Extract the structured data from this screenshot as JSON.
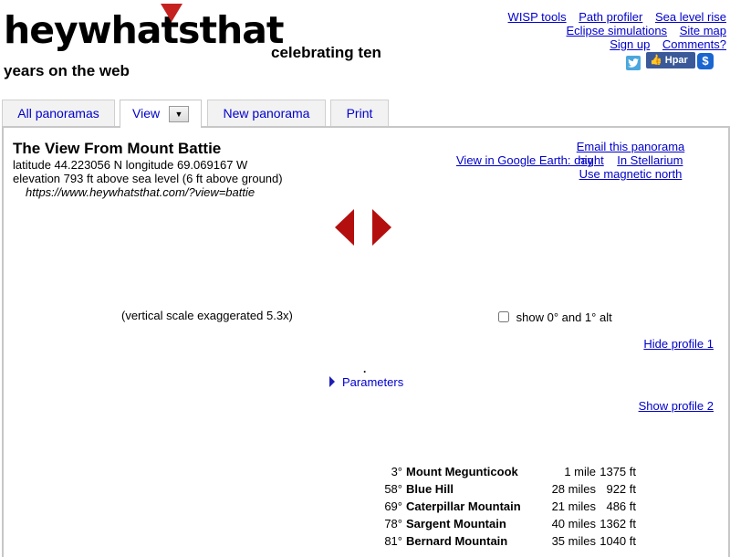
{
  "header": {
    "logo_text": "heywhatsthat",
    "tagline_line1": "celebrating ten",
    "tagline_line2": "years on the web",
    "top_links": {
      "wisp_tools": "WISP tools",
      "path_profiler": "Path profiler",
      "sea_level_rise": "Sea level rise",
      "eclipse_simulations": "Eclipse simulations",
      "site_map": "Site map",
      "sign_up": "Sign up",
      "comments": "Comments?"
    },
    "facebook_label": "Hpar",
    "dollar_label": "$"
  },
  "tabs": {
    "all_panoramas": "All panoramas",
    "view": "View",
    "view_dropdown": "▼",
    "new_panorama": "New panorama",
    "print": "Print"
  },
  "panorama": {
    "title": "The View From Mount Battie",
    "latlon": "latitude 44.223056 N longitude 69.069167 W",
    "elevation": "elevation 793 ft above sea level (6 ft above ground)",
    "url": "https://www.heywhatsthat.com/?view=battie",
    "google_earth_day": "View in Google Earth: day",
    "email": "Email this panorama",
    "night": "night",
    "stellarium": "In Stellarium",
    "magnetic_north": "Use magnetic north",
    "vertical_scale": "(vertical scale exaggerated 5.3x)",
    "show_alt_label": "show 0° and 1° alt",
    "hide_profile_1": "Hide profile 1",
    "dot": ".",
    "parameters": "Parameters",
    "show_profile_2": "Show profile 2"
  },
  "peaks": [
    {
      "az": "3°",
      "name": "Mount Megunticook",
      "dist": "1 mile",
      "elev": "1375 ft"
    },
    {
      "az": "58°",
      "name": "Blue Hill",
      "dist": "28 miles",
      "elev": "922 ft"
    },
    {
      "az": "69°",
      "name": "Caterpillar Mountain",
      "dist": "21 miles",
      "elev": "486 ft"
    },
    {
      "az": "78°",
      "name": "Sargent Mountain",
      "dist": "40 miles",
      "elev": "1362 ft"
    },
    {
      "az": "81°",
      "name": "Bernard Mountain",
      "dist": "35 miles",
      "elev": "1040 ft"
    }
  ],
  "colors": {
    "link": "#0000cc",
    "arrow": "#b40f0f",
    "logo_triangle": "#c5221f"
  }
}
